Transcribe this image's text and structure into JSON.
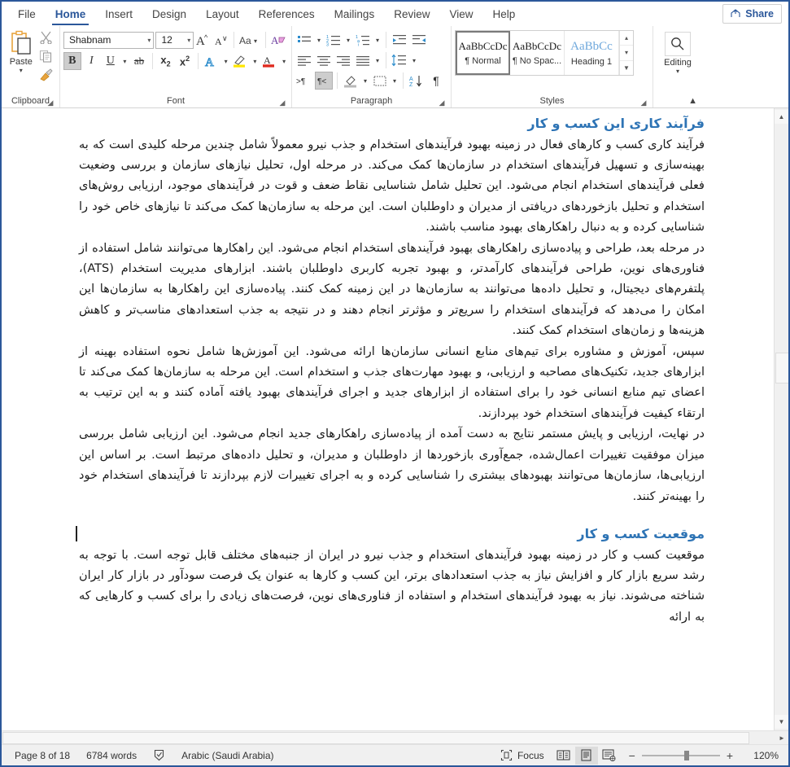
{
  "window": {
    "accent_color": "#2b579a"
  },
  "ribbon": {
    "tabs": [
      {
        "label": "File",
        "active": false
      },
      {
        "label": "Home",
        "active": true
      },
      {
        "label": "Insert",
        "active": false
      },
      {
        "label": "Design",
        "active": false
      },
      {
        "label": "Layout",
        "active": false
      },
      {
        "label": "References",
        "active": false
      },
      {
        "label": "Mailings",
        "active": false
      },
      {
        "label": "Review",
        "active": false
      },
      {
        "label": "View",
        "active": false
      },
      {
        "label": "Help",
        "active": false
      }
    ],
    "share_label": "Share",
    "groups": {
      "clipboard": {
        "label": "Clipboard",
        "paste_label": "Paste",
        "items": [
          "cut-icon",
          "copy-icon",
          "format-painter-icon"
        ]
      },
      "font": {
        "label": "Font",
        "font_name": "Shabnam",
        "font_size": "12",
        "buttons": [
          "grow-font-icon",
          "shrink-font-icon",
          "change-case-icon",
          "clear-formatting-icon",
          "bold-icon",
          "italic-icon",
          "underline-icon",
          "strikethrough-icon",
          "subscript-icon",
          "superscript-icon",
          "text-effects-icon",
          "text-highlight-icon",
          "font-color-icon"
        ],
        "bold_active": true
      },
      "paragraph": {
        "label": "Paragraph",
        "buttons": [
          "bullets-icon",
          "numbering-icon",
          "multilevel-list-icon",
          "increase-indent-icon",
          "decrease-indent-icon",
          "align-left-icon",
          "align-center-icon",
          "align-right-icon",
          "justify-icon",
          "line-spacing-icon",
          "ltr-text-icon",
          "rtl-text-icon",
          "shading-icon",
          "borders-icon",
          "sort-icon",
          "show-marks-icon"
        ],
        "rtl_active": true
      },
      "styles": {
        "label": "Styles",
        "items": [
          {
            "preview": "AaBbCcDc",
            "name": "¶ Normal",
            "selected": true
          },
          {
            "preview": "AaBbCcDc",
            "name": "¶ No Spac...",
            "selected": false
          },
          {
            "preview": "AaBbCc",
            "name": "Heading 1",
            "selected": false
          }
        ]
      },
      "editing": {
        "label": "Editing",
        "button_label": "Editing",
        "icon": "search-icon"
      }
    }
  },
  "document": {
    "blocks": [
      {
        "type": "heading",
        "text": "فرآیند کاری این کسب و کار",
        "cursor": false
      },
      {
        "type": "paragraph",
        "text": "فرآیند کاری کسب و کارهای فعال در زمینه بهبود فرآیندهای استخدام و جذب نیرو معمولاً شامل چندین مرحله کلیدی است که به بهینه‌سازی و تسهیل فرآیندهای استخدام در سازمان‌ها کمک می‌کند. در مرحله اول، تحلیل نیازهای سازمان و بررسی وضعیت فعلی فرآیندهای استخدام انجام می‌شود. این تحلیل شامل شناسایی نقاط ضعف و قوت در فرآیندهای موجود، ارزیابی روش‌های استخدام و تحلیل بازخوردهای دریافتی از مدیران و داوطلبان است. این مرحله به سازمان‌ها کمک می‌کند تا نیازهای خاص خود را شناسایی کرده و به دنبال راهکارهای بهبود مناسب باشند."
      },
      {
        "type": "paragraph",
        "text": "در مرحله بعد، طراحی و پیاده‌سازی راهکارهای بهبود فرآیندهای استخدام انجام می‌شود. این راهکارها می‌توانند شامل استفاده از فناوری‌های نوین، طراحی فرآیندهای کارآمدتر، و بهبود تجربه کاربری داوطلبان باشند. ابزارهای مدیریت استخدام (ATS)، پلتفرم‌های دیجیتال، و تحلیل داده‌ها می‌توانند به سازمان‌ها در این زمینه کمک کنند. پیاده‌سازی این راهکارها به سازمان‌ها این امکان را می‌دهد که فرآیندهای استخدام را سریع‌تر و مؤثرتر انجام دهند و در نتیجه به جذب استعدادهای مناسب‌تر و کاهش هزینه‌ها و زمان‌های استخدام کمک کنند."
      },
      {
        "type": "paragraph",
        "text": "سپس، آموزش و مشاوره برای تیم‌های منابع انسانی سازمان‌ها ارائه می‌شود. این آموزش‌ها شامل نحوه استفاده بهینه از ابزارهای جدید، تکنیک‌های مصاحبه و ارزیابی، و بهبود مهارت‌های جذب و استخدام است. این مرحله به سازمان‌ها کمک می‌کند تا اعضای تیم منابع انسانی خود را برای استفاده از ابزارهای جدید و اجرای فرآیندهای بهبود یافته آماده کنند و به این ترتیب به ارتقاء کیفیت فرآیندهای استخدام خود بپردازند."
      },
      {
        "type": "paragraph",
        "text": "در نهایت، ارزیابی و پایش مستمر نتایج به دست آمده از پیاده‌سازی راهکارهای جدید انجام می‌شود. این ارزیابی شامل بررسی میزان موفقیت تغییرات اعمال‌شده، جمع‌آوری بازخوردها از داوطلبان و مدیران، و تحلیل داده‌های مرتبط است. بر اساس این ارزیابی‌ها، سازمان‌ها می‌توانند بهبودهای بیشتری را شناسایی کرده و به اجرای تغییرات لازم بپردازند تا فرآیندهای استخدام خود را بهینه‌تر کنند."
      },
      {
        "type": "heading",
        "text": "موقعیت کسب و کار",
        "cursor": true
      },
      {
        "type": "paragraph",
        "text": "موقعیت کسب و کار در زمینه بهبود فرآیندهای استخدام و جذب نیرو در ایران از جنبه‌های مختلف قابل توجه است. با توجه به رشد سریع بازار کار و افزایش نیاز به جذب استعدادهای برتر، این کسب و کارها به عنوان یک فرصت سودآور در بازار کار ایران شناخته می‌شوند. نیاز به بهبود فرآیندهای استخدام و استفاده از فناوری‌های نوین، فرصت‌های زیادی را برای کسب و کارهایی که به ارائه"
      }
    ],
    "heading_color": "#2e74b5"
  },
  "status_bar": {
    "page": "Page 8 of 18",
    "words": "6784 words",
    "proofing_icon": "spell-check-icon",
    "language": "Arabic (Saudi Arabia)",
    "focus_label": "Focus",
    "views": [
      "read-mode-icon",
      "print-layout-icon",
      "web-layout-icon"
    ],
    "active_view_index": 1,
    "zoom_out": "−",
    "zoom_in": "+",
    "zoom_level": "120%"
  }
}
